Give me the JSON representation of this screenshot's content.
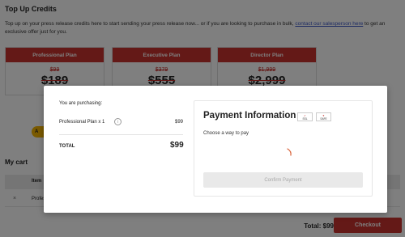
{
  "page": {
    "title": "Top Up Credits",
    "intro_text": "Top up on your press release credits here to start sending your press release now... or if you are looking to purchase in bulk, ",
    "intro_link": "contact our salesperson here",
    "intro_tail": " to get an exclusive offer just for you."
  },
  "plans": [
    {
      "name": "Professional Plan",
      "original_price": "$99",
      "price": "$189"
    },
    {
      "name": "Executive Plan",
      "original_price": "$379",
      "price": "$555"
    },
    {
      "name": "Director Plan",
      "original_price": "$1,999",
      "price": "$2,999"
    }
  ],
  "plan_button_label": "A",
  "cart": {
    "title": "My cart",
    "header_item": "Item",
    "row_name": "Professional",
    "remove_icon": "×",
    "total_label": "Total: $99",
    "checkout_label": "Checkout"
  },
  "modal": {
    "purchasing_label": "You are purchasing:",
    "item_name": "Professional Plan x 1",
    "item_price": "$99",
    "total_label": "TOTAL",
    "total_value": "$99",
    "payment_title": "Payment Information",
    "choose_label": "Choose a way to pay",
    "confirm_label": "Confirm Payment"
  },
  "colors": {
    "accent_red": "#c8322e",
    "button_yellow": "#f4b400"
  }
}
